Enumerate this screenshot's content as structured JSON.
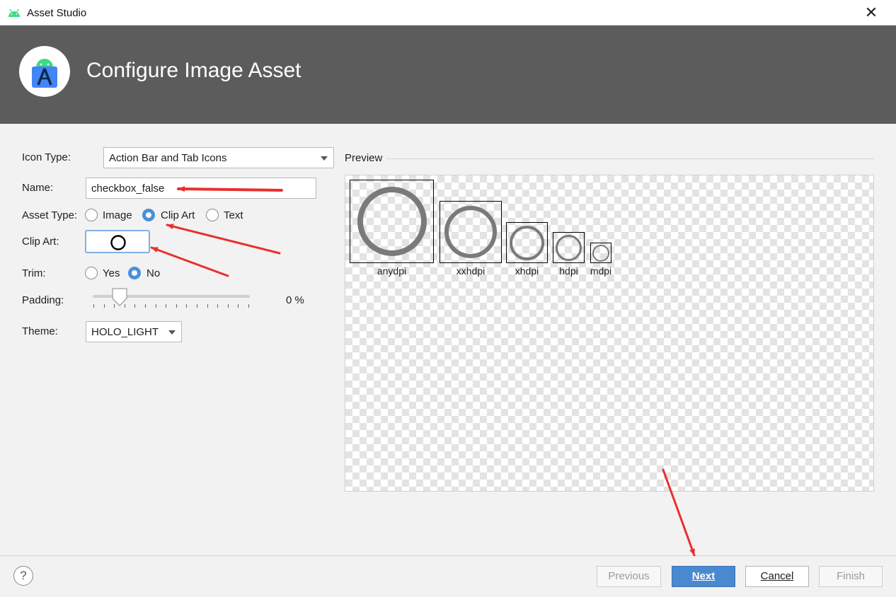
{
  "window": {
    "title": "Asset Studio",
    "close_glyph": "✕"
  },
  "banner": {
    "heading": "Configure Image Asset",
    "logo_icon": "android-studio-logo-icon"
  },
  "form": {
    "icon_type": {
      "label": "Icon Type:",
      "value": "Action Bar and Tab Icons"
    },
    "name": {
      "label": "Name:",
      "value": "checkbox_false"
    },
    "asset_type": {
      "label": "Asset Type:",
      "options": [
        "Image",
        "Clip Art",
        "Text"
      ],
      "selected": "Clip Art"
    },
    "clip_art": {
      "label": "Clip Art:",
      "icon": "circle-outline-icon"
    },
    "trim": {
      "label": "Trim:",
      "options": [
        "Yes",
        "No"
      ],
      "selected": "No"
    },
    "padding": {
      "label": "Padding:",
      "value": "0 %",
      "fraction": 0.1
    },
    "theme": {
      "label": "Theme:",
      "value": "HOLO_LIGHT"
    }
  },
  "preview": {
    "label": "Preview",
    "densities": [
      "anydpi",
      "xxhdpi",
      "xhdpi",
      "hdpi",
      "mdpi"
    ]
  },
  "footer": {
    "help": "?",
    "previous": "Previous",
    "next": "Next",
    "cancel": "Cancel",
    "finish": "Finish"
  },
  "colors": {
    "banner": "#5c5c5c",
    "accent": "#4a90d9",
    "annotation_arrow": "#e8302f"
  }
}
